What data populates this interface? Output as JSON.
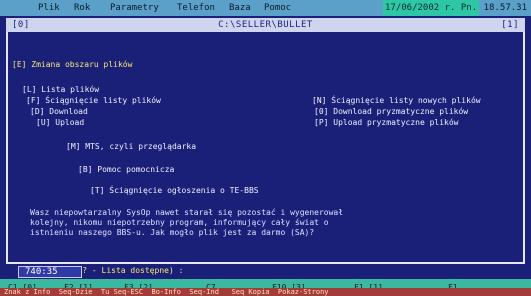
{
  "menubar": {
    "items": [
      "Plik",
      "Rok",
      "Parametry",
      "Telefon",
      "Baza",
      "Pomoc"
    ],
    "highlight": "17/06/2002 r. Pn.",
    "clock": "18.57.31"
  },
  "titlebar": {
    "left": "[0]",
    "center": "C:\\SELLER\\BULLET",
    "right": "[1]"
  },
  "content": {
    "header": "[E] Zmiana obszaru plików",
    "section_list": "[L] Lista plików",
    "item_sciag_list": "[F] Ściągnięcie listy plików",
    "item_sciag_new": "[N] Ściągnięcie listy nowych plików",
    "item_download": "[D] Download",
    "item_download_proto": "[0] Download pryzmatyczne plików",
    "item_upload": "[U] Upload",
    "item_upload_proto": "[P] Upload pryzmatyczne plików",
    "item_mts": "[M] MTS, czyli przeglądarka",
    "item_pomoc": "[B] Pomoc pomocnicza",
    "item_ogloszenia": "[T] Ściągnięcie ogłoszenia o TE-BBS",
    "paragraph": "Wasz niepowtarzalny SysOp nawet starał się pozostać i wygenerował\nkolejny, nikomu niepotrzebny program, informujący cały świat o\nistnieniu naszego BBS-u. Jak mogło plik jest za darmo (SA)?",
    "prompt": "Wybór akcji (? - Lista dostępne) :",
    "input_value": "740:35"
  },
  "fkeys": [
    "C1 [0]",
    "F2 [1]",
    "F3 [2]",
    "C7",
    "F10 [3]",
    "F1 [1]",
    "F1"
  ],
  "bottombar": "Znak z Info  Seq-Dzie  Tu Seq-ESC  Bo-Info  Seq-Ind   Seq Kopia  Pokaz-Strony"
}
